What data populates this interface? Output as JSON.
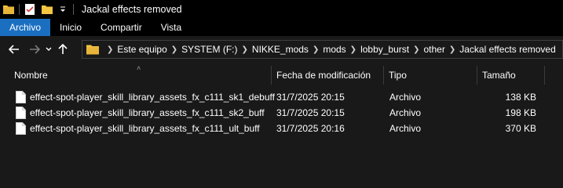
{
  "window": {
    "title": "Jackal effects removed"
  },
  "ribbon": {
    "tabs": [
      {
        "label": "Archivo",
        "active": true
      },
      {
        "label": "Inicio",
        "active": false
      },
      {
        "label": "Compartir",
        "active": false
      },
      {
        "label": "Vista",
        "active": false
      }
    ]
  },
  "nav": {
    "back_icon": "arrow-left-icon",
    "forward_icon": "arrow-right-icon",
    "recent_icon": "chevron-down-icon",
    "up_icon": "arrow-up-icon"
  },
  "breadcrumb": [
    "Este equipo",
    "SYSTEM (F:)",
    "NIKKE_mods",
    "mods",
    "lobby_burst",
    "other",
    "Jackal effects removed"
  ],
  "columns": {
    "name": "Nombre",
    "date": "Fecha de modificación",
    "type": "Tipo",
    "size": "Tamaño"
  },
  "files": [
    {
      "name": "effect-spot-player_skill_library_assets_fx_c111_sk1_debuff",
      "date": "31/7/2025 20:15",
      "type": "Archivo",
      "size": "138 KB"
    },
    {
      "name": "effect-spot-player_skill_library_assets_fx_c111_sk2_buff",
      "date": "31/7/2025 20:15",
      "type": "Archivo",
      "size": "198 KB"
    },
    {
      "name": "effect-spot-player_skill_library_assets_fx_c111_ult_buff",
      "date": "31/7/2025 20:16",
      "type": "Archivo",
      "size": "370 KB"
    }
  ],
  "colors": {
    "accent": "#1a6fc1",
    "background": "#191919",
    "titlebar": "#000000",
    "folder": "#f4c542"
  }
}
